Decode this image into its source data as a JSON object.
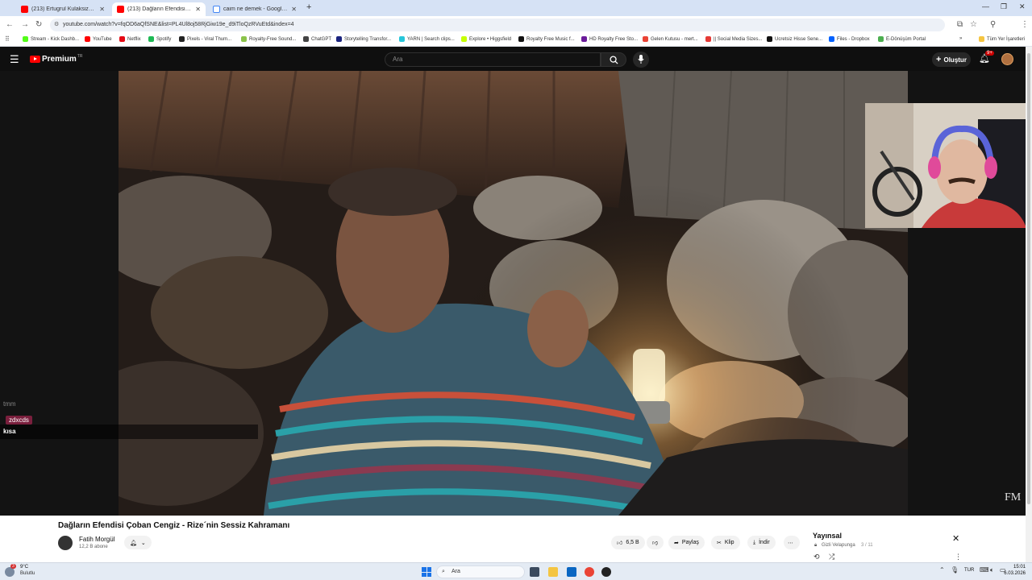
{
  "browser": {
    "tabs": [
      {
        "label": "(213) Ertugrul Kulaksizoglu - Yo",
        "active": false,
        "icon": "youtube-icon"
      },
      {
        "label": "(213) Dağların Efendisi Çoba",
        "active": true,
        "icon": "youtube-icon"
      },
      {
        "label": "caim ne demek - Google'da Ar",
        "active": false,
        "icon": "google-icon"
      }
    ],
    "new_tab": "+",
    "url": "youtube.com/watch?v=fqOD6aQfSNE&list=PL4Ul8oj58RjGiw19e_d9iTloQzRVuEtd&index=4",
    "bookmarks": [
      {
        "label": "Stream - Kick Dashb...",
        "color": "#53fc18"
      },
      {
        "label": "YouTube",
        "color": "#ff0000"
      },
      {
        "label": "Netflix",
        "color": "#e50914"
      },
      {
        "label": "Spotify",
        "color": "#1db954"
      },
      {
        "label": "Pixels - Viral Thum...",
        "color": "#222222"
      },
      {
        "label": "Royalty-Free Sound...",
        "color": "#8bc34a"
      },
      {
        "label": "ChatGPT",
        "color": "#444444"
      },
      {
        "label": "Storytelling Transfor...",
        "color": "#1a237e"
      },
      {
        "label": "YARN | Search clips...",
        "color": "#26c6da"
      },
      {
        "label": "Explore • Higgsfield",
        "color": "#c6ff00"
      },
      {
        "label": "Royalty Free Music f...",
        "color": "#111111"
      },
      {
        "label": "HD Royalty Free Sto...",
        "color": "#6a1b9a"
      },
      {
        "label": "Gelen Kutusu - mert...",
        "color": "#ea4335"
      },
      {
        "label": "|| Social Media Sizes...",
        "color": "#e53935"
      },
      {
        "label": "Ucretsiz Hisse Sene...",
        "color": "#111111"
      },
      {
        "label": "Files - Dropbox",
        "color": "#0061ff"
      },
      {
        "label": "E-Dönüşüm Portal",
        "color": "#4caf50"
      }
    ],
    "all_bookmarks": "Tüm Yer İşaretleri",
    "more": "»"
  },
  "yt": {
    "logo": "Premium",
    "logo_sup": "TR",
    "search_placeholder": "Ara",
    "create_label": "Oluştur",
    "notif_count": "9+"
  },
  "chat": {
    "lines": [
      {
        "text": "tmm",
        "color": "#cccccc",
        "bold": false
      },
      {
        "text": "zdxcds",
        "color": "#ffffff",
        "bold": false,
        "highlight": "#7a1f3d"
      },
      {
        "text": "kısa",
        "color": "#ffffff",
        "bold": true
      }
    ]
  },
  "video": {
    "watermark": "FM"
  },
  "below": {
    "title": "Dağların Efendisi Çoban Cengiz - Rize´nin Sessiz Kahramanı",
    "channel": "Fatih Morgül",
    "subs": "12,2 B abone",
    "likes": "6,5 B",
    "share": "Paylaş",
    "clip": "Klip",
    "download": "İndir",
    "more": "⋯",
    "playlist_title": "Yayınsal",
    "playlist_sub": "Gizli Velapunga",
    "playlist_pos": "3 / 11"
  },
  "taskbar": {
    "weather_temp": "9°C",
    "weather_desc": "Bulutlu",
    "weather_badge": "3",
    "search": "Ara",
    "lang": "TUR",
    "time": "15:01",
    "date": "6.03.2026"
  },
  "colors": {
    "yt_red": "#ff0000",
    "dark_bg": "#0f0f0f"
  }
}
